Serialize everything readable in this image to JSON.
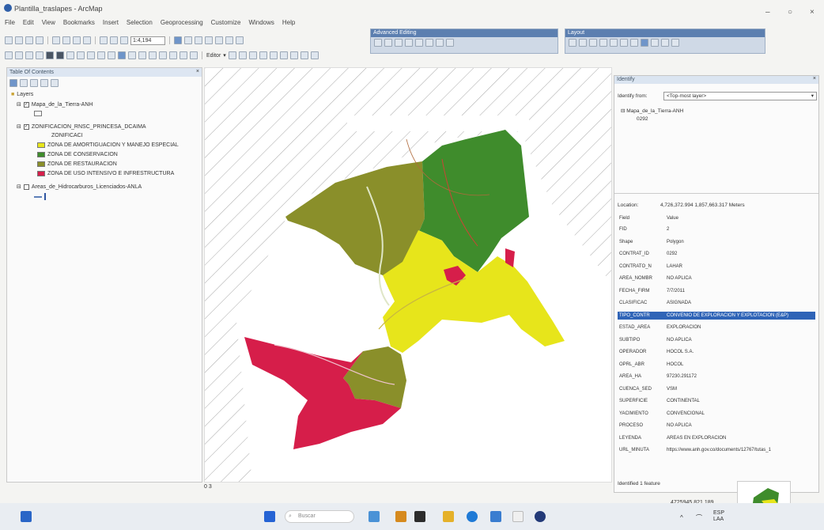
{
  "window": {
    "title": "Plantilla_traslapes - ArcMap"
  },
  "menu": [
    "File",
    "Edit",
    "View",
    "Bookmarks",
    "Insert",
    "Selection",
    "Geoprocessing",
    "Customize",
    "Windows",
    "Help"
  ],
  "toolbar": {
    "scale": "1:4,194",
    "editor_label": "Editor"
  },
  "float_toolbars": {
    "feature_editing": "Advanced Editing",
    "layout": "Layout"
  },
  "toc": {
    "title": "Table Of Contents",
    "root": "Layers",
    "layers": [
      {
        "name": "Mapa_de_la_Tierra-ANH",
        "checked": true
      },
      {
        "name": "ZONIFICACION_RNSC_PRINCESA_DCAIMA",
        "checked": true,
        "sub": "ZONIFICACI"
      },
      {
        "name": "Areas_de_Hidrocarburos_Licenciados-ANLA",
        "checked": false
      }
    ],
    "legend": [
      {
        "label": "ZONA DE AMORTIGUACION Y MANEJO ESPECIAL",
        "color": "#e7e51b"
      },
      {
        "label": "ZONA DE CONSERVACION",
        "color": "#3f8c2c"
      },
      {
        "label": "ZONA DE RESTAURACION",
        "color": "#8a8f2a"
      },
      {
        "label": "ZONA DE USO INTENSIVO E INFRESTRUCTURA",
        "color": "#d61e4a"
      }
    ]
  },
  "identify": {
    "title": "Identify",
    "from_label": "Identify from:",
    "from_value": "<Top-most layer>",
    "tree_root": "Mapa_de_la_Tierra-ANH",
    "tree_child": "0292",
    "location_label": "Location:",
    "location_value": "4,726,372.994  1,857,663.317 Meters",
    "header_field": "Field",
    "header_value": "Value",
    "fields": [
      {
        "name": "FID",
        "value": "2"
      },
      {
        "name": "Shape",
        "value": "Polygon"
      },
      {
        "name": "CONTRAT_ID",
        "value": "0292"
      },
      {
        "name": "CONTRATO_N",
        "value": "LAHAR"
      },
      {
        "name": "AREA_NOMBR",
        "value": "NO APLICA"
      },
      {
        "name": "FECHA_FIRM",
        "value": "7/7/2011"
      },
      {
        "name": "CLASIFICAC",
        "value": "ASIGNADA"
      },
      {
        "name": "TIPO_CONTR",
        "value": "CONVENIO DE EXPLORACION Y EXPLOTACION (E&P)",
        "selected": true
      },
      {
        "name": "ESTAD_AREA",
        "value": "EXPLORACION"
      },
      {
        "name": "SUBTIPO",
        "value": "NO APLICA"
      },
      {
        "name": "OPERADOR",
        "value": "HOCOL S.A."
      },
      {
        "name": "OPRL_ABR",
        "value": "HOCOL"
      },
      {
        "name": "AREA_HA",
        "value": "97230.291172"
      },
      {
        "name": "CUENCA_SED",
        "value": "VSM"
      },
      {
        "name": "SUPERFICIE",
        "value": "CONTINENTAL"
      },
      {
        "name": "YACIMIENTO",
        "value": "CONVENCIONAL"
      },
      {
        "name": "PROCESO",
        "value": "NO APLICA"
      },
      {
        "name": "LEYENDA",
        "value": "AREAS EN EXPLORACION"
      },
      {
        "name": "URL_MINUTA",
        "value": "https://www.anh.gov.co/documents/12767/tutas_1"
      }
    ],
    "status": "Identified 1 feature"
  },
  "statusbar": {
    "coords": "4725945.821  189",
    "page": "0 3"
  },
  "taskbar": {
    "search_placeholder": "Buscar",
    "lang": "ESP",
    "lang2": "LAA"
  },
  "colors": {
    "amortiguacion": "#e7e51b",
    "conservacion": "#3f8c2c",
    "restauracion": "#8a8f2a",
    "uso_intensivo": "#d61e4a",
    "selection": "#2f64b7"
  }
}
